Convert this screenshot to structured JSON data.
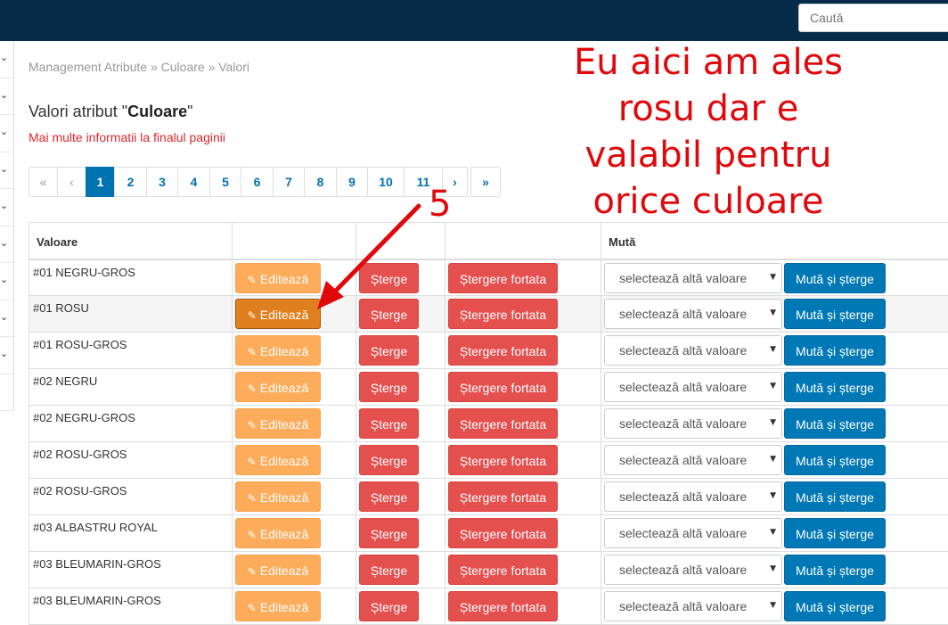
{
  "topbar": {
    "search_placeholder": "Caută"
  },
  "breadcrumb": "Management Atribute » Culoare » Valori",
  "title": {
    "prefix": "Valori atribut \"",
    "attribute": "Culoare",
    "suffix": "\""
  },
  "info_link": "Mai multe informatii la finalul paginii",
  "pagination": {
    "first": "«",
    "prev": "‹",
    "next": "›",
    "last": "»",
    "pages": [
      "1",
      "2",
      "3",
      "4",
      "5",
      "6",
      "7",
      "8",
      "9",
      "10",
      "11"
    ],
    "active": "1"
  },
  "annotation": {
    "lines": [
      "Eu aici am ales",
      "rosu dar e",
      "valabil pentru",
      "orice culoare"
    ],
    "step": "5",
    "color": "#e0080b"
  },
  "table": {
    "headers": {
      "value": "Valoare",
      "move": "Mută"
    },
    "labels": {
      "edit": "Editează",
      "delete": "Șterge",
      "force_delete": "Ștergere fortata",
      "select_placeholder": "selectează altă valoare",
      "move": "Mută și șterge"
    },
    "rows": [
      {
        "value": "#01 NEGRU-GROS"
      },
      {
        "value": "#01 ROSU"
      },
      {
        "value": "#01 ROSU-GROS"
      },
      {
        "value": "#02 NEGRU"
      },
      {
        "value": "#02 NEGRU-GROS"
      },
      {
        "value": "#02 ROSU-GROS"
      },
      {
        "value": "#02 ROSU-GROS"
      },
      {
        "value": "#03 ALBASTRU ROYAL"
      },
      {
        "value": "#03 BLEUMARIN-GROS"
      },
      {
        "value": "#03 BLEUMARIN-GROS"
      }
    ]
  },
  "colors": {
    "topbar": "#072c4a",
    "primary": "#0072b0",
    "warning": "#fcac5a",
    "danger": "#e3504e"
  }
}
